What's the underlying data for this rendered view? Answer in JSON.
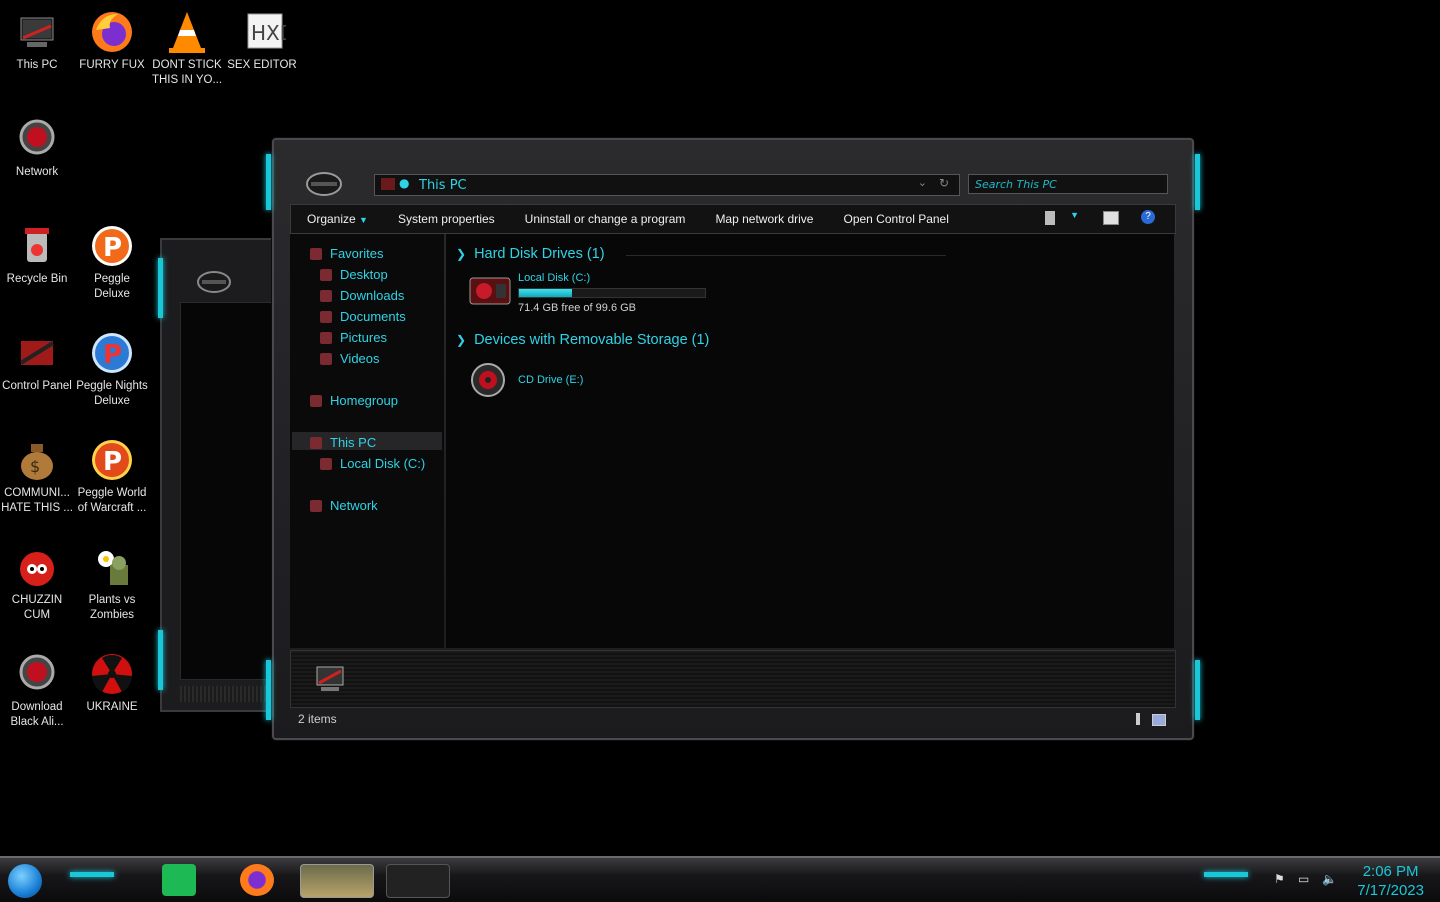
{
  "desktop_icons": [
    {
      "name": "this-pc",
      "label": "This PC"
    },
    {
      "name": "furry-fux",
      "label": "FURRY FUX"
    },
    {
      "name": "dont-stick",
      "label": "DONT STICK THIS IN YO..."
    },
    {
      "name": "sex-editor",
      "label": "SEX EDITOR"
    },
    {
      "name": "network",
      "label": "Network"
    },
    {
      "name": "recycle-bin",
      "label": "Recycle Bin"
    },
    {
      "name": "peggle-deluxe",
      "label": "Peggle Deluxe"
    },
    {
      "name": "control-panel",
      "label": "Control Panel"
    },
    {
      "name": "peggle-nights",
      "label": "Peggle Nights Deluxe"
    },
    {
      "name": "communi",
      "label": "COMMUNI... HATE THIS ..."
    },
    {
      "name": "peggle-world",
      "label": "Peggle World of Warcraft ..."
    },
    {
      "name": "chuzzin",
      "label": "CHUZZIN CUM"
    },
    {
      "name": "plants-vs-zombies",
      "label": "Plants vs Zombies"
    },
    {
      "name": "download-black-ali",
      "label": "Download Black Ali..."
    },
    {
      "name": "ukraine",
      "label": "UKRAINE"
    }
  ],
  "explorer": {
    "address": "This PC",
    "search_placeholder": "Search This PC",
    "toolbar": {
      "organize": "Organize",
      "system_properties": "System properties",
      "uninstall": "Uninstall or change a program",
      "map_drive": "Map network drive",
      "control_panel": "Open Control Panel"
    },
    "nav": {
      "favorites": "Favorites",
      "desktop": "Desktop",
      "downloads": "Downloads",
      "documents": "Documents",
      "pictures": "Pictures",
      "videos": "Videos",
      "homegroup": "Homegroup",
      "this_pc": "This PC",
      "local_disk": "Local Disk (C:)",
      "network": "Network"
    },
    "groups": {
      "hdd": "Hard Disk Drives (1)",
      "removable": "Devices with Removable Storage (1)"
    },
    "drives": {
      "c_name": "Local Disk (C:)",
      "c_free": "71.4 GB free of 99.6 GB",
      "c_used_fraction": 0.283,
      "e_name": "CD Drive (E:)"
    },
    "status": "2 items"
  },
  "taskbar": {
    "time": "2:06 PM",
    "date": "7/17/2023"
  },
  "colors": {
    "accent": "#19c7d8",
    "text_accent": "#2fd3e6"
  }
}
